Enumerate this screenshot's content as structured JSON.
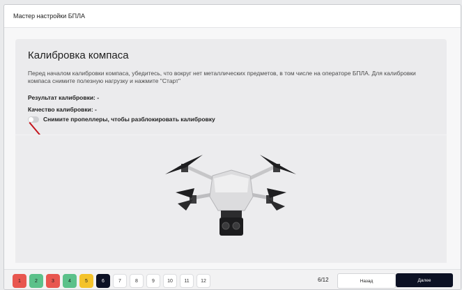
{
  "window": {
    "title": "Мастер настройки БПЛА"
  },
  "panel": {
    "heading": "Калибровка компаса",
    "description": "Перед началом калибровки компаса, убедитесь, что вокруг нет металлических предметов, в том числе на операторе БПЛА. Для калибровки компаса снимите полезную нагрузку и нажмите \"Старт\"",
    "result_label": "Результат калибровки: -",
    "quality_label": "Качество калибровки: -",
    "toggle_label": "Снимите пропеллеры, чтобы разблокировать калибровку",
    "marker": "1"
  },
  "steps": [
    {
      "label": "1",
      "color": "#e8564f"
    },
    {
      "label": "2",
      "color": "#5cc18a"
    },
    {
      "label": "3",
      "color": "#e8564f"
    },
    {
      "label": "4",
      "color": "#5cc18a"
    },
    {
      "label": "5",
      "color": "#f4c32b"
    },
    {
      "label": "6",
      "color": "#0c1124"
    },
    {
      "label": "7",
      "color": "#ffffff"
    },
    {
      "label": "8",
      "color": "#ffffff"
    },
    {
      "label": "9",
      "color": "#ffffff"
    },
    {
      "label": "10",
      "color": "#ffffff"
    },
    {
      "label": "11",
      "color": "#ffffff"
    },
    {
      "label": "12",
      "color": "#ffffff"
    }
  ],
  "footer": {
    "counter": "6/12",
    "back_label": "Назад",
    "next_label": "Далее"
  }
}
